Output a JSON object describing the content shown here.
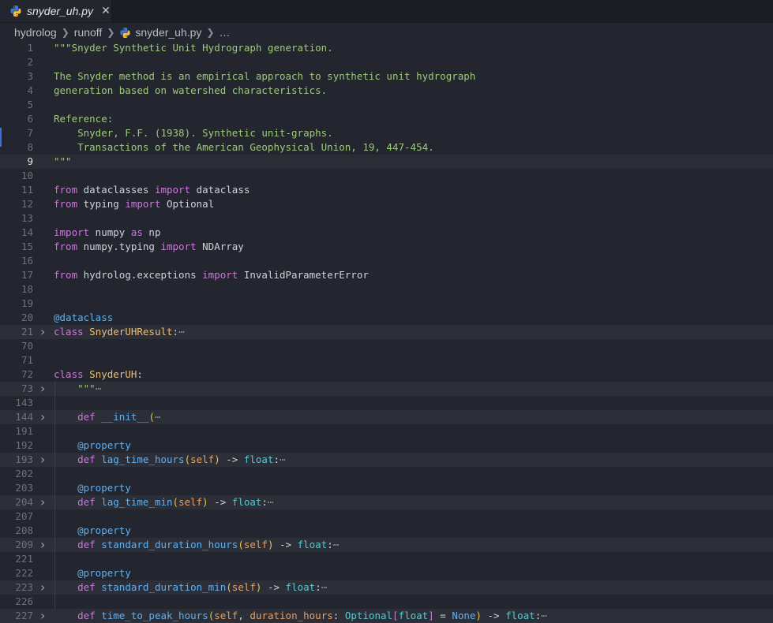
{
  "tab": {
    "filename": "snyder_uh.py",
    "close": "✕"
  },
  "breadcrumb": {
    "items": [
      "hydrolog",
      "runoff",
      "snyder_uh.py",
      "…"
    ]
  },
  "lines": [
    {
      "n": "1",
      "tokens": [
        [
          "str",
          "\"\"\"Snyder Synthetic Unit Hydrograph generation."
        ]
      ]
    },
    {
      "n": "2",
      "tokens": []
    },
    {
      "n": "3",
      "tokens": [
        [
          "str",
          "The Snyder method is an empirical approach to synthetic unit hydrograph"
        ]
      ]
    },
    {
      "n": "4",
      "tokens": [
        [
          "str",
          "generation based on watershed characteristics."
        ]
      ]
    },
    {
      "n": "5",
      "tokens": []
    },
    {
      "n": "6",
      "tokens": [
        [
          "str",
          "Reference:"
        ]
      ]
    },
    {
      "n": "7",
      "tokens": [
        [
          "str",
          "    Snyder, F.F. (1938). Synthetic unit-graphs."
        ]
      ]
    },
    {
      "n": "8",
      "tokens": [
        [
          "str",
          "    Transactions of the American Geophysical Union, 19, 447-454."
        ]
      ]
    },
    {
      "n": "9",
      "active": true,
      "tokens": [
        [
          "str",
          "\"\"\""
        ]
      ]
    },
    {
      "n": "10",
      "tokens": []
    },
    {
      "n": "11",
      "tokens": [
        [
          "kw",
          "from"
        ],
        [
          "",
          " dataclasses "
        ],
        [
          "kw",
          "import"
        ],
        [
          "",
          " dataclass"
        ]
      ]
    },
    {
      "n": "12",
      "tokens": [
        [
          "kw",
          "from"
        ],
        [
          "",
          " typing "
        ],
        [
          "kw",
          "import"
        ],
        [
          "",
          " Optional"
        ]
      ]
    },
    {
      "n": "13",
      "tokens": []
    },
    {
      "n": "14",
      "tokens": [
        [
          "kw",
          "import"
        ],
        [
          "",
          " numpy "
        ],
        [
          "kw",
          "as"
        ],
        [
          "",
          " np"
        ]
      ]
    },
    {
      "n": "15",
      "tokens": [
        [
          "kw",
          "from"
        ],
        [
          "",
          " numpy.typing "
        ],
        [
          "kw",
          "import"
        ],
        [
          "",
          " NDArray"
        ]
      ]
    },
    {
      "n": "16",
      "tokens": []
    },
    {
      "n": "17",
      "tokens": [
        [
          "kw",
          "from"
        ],
        [
          "",
          " hydrolog.exceptions "
        ],
        [
          "kw",
          "import"
        ],
        [
          "",
          " InvalidParameterError"
        ]
      ]
    },
    {
      "n": "18",
      "tokens": []
    },
    {
      "n": "19",
      "tokens": []
    },
    {
      "n": "20",
      "tokens": [
        [
          "fn",
          "@dataclass"
        ]
      ]
    },
    {
      "n": "21",
      "fold": true,
      "tokens": [
        [
          "kw",
          "class"
        ],
        [
          "",
          " "
        ],
        [
          "cls",
          "SnyderUHResult"
        ],
        [
          "",
          ":"
        ],
        [
          "ell",
          "⋯"
        ]
      ]
    },
    {
      "n": "70",
      "tokens": []
    },
    {
      "n": "71",
      "tokens": []
    },
    {
      "n": "72",
      "tokens": [
        [
          "kw",
          "class"
        ],
        [
          "",
          " "
        ],
        [
          "cls",
          "SnyderUH"
        ],
        [
          "",
          ":"
        ]
      ]
    },
    {
      "n": "73",
      "fold": true,
      "tokens": [
        [
          "",
          "    "
        ],
        [
          "str",
          "\"\"\""
        ],
        [
          "ell",
          "⋯"
        ]
      ]
    },
    {
      "n": "143",
      "tokens": []
    },
    {
      "n": "144",
      "fold": true,
      "tokens": [
        [
          "",
          "    "
        ],
        [
          "kw",
          "def"
        ],
        [
          "",
          " "
        ],
        [
          "fn",
          "__init__"
        ],
        [
          "par",
          "("
        ],
        [
          "ell",
          "⋯"
        ]
      ]
    },
    {
      "n": "191",
      "tokens": []
    },
    {
      "n": "192",
      "tokens": [
        [
          "",
          "    "
        ],
        [
          "fn",
          "@property"
        ]
      ]
    },
    {
      "n": "193",
      "fold": true,
      "tokens": [
        [
          "",
          "    "
        ],
        [
          "kw",
          "def"
        ],
        [
          "",
          " "
        ],
        [
          "fn",
          "lag_time_hours"
        ],
        [
          "par",
          "("
        ],
        [
          "self",
          "self"
        ],
        [
          "par",
          ")"
        ],
        [
          "",
          " -> "
        ],
        [
          "typ",
          "float"
        ],
        [
          "",
          ":"
        ],
        [
          "ell",
          "⋯"
        ]
      ]
    },
    {
      "n": "202",
      "tokens": []
    },
    {
      "n": "203",
      "tokens": [
        [
          "",
          "    "
        ],
        [
          "fn",
          "@property"
        ]
      ]
    },
    {
      "n": "204",
      "fold": true,
      "tokens": [
        [
          "",
          "    "
        ],
        [
          "kw",
          "def"
        ],
        [
          "",
          " "
        ],
        [
          "fn",
          "lag_time_min"
        ],
        [
          "par",
          "("
        ],
        [
          "self",
          "self"
        ],
        [
          "par",
          ")"
        ],
        [
          "",
          " -> "
        ],
        [
          "typ",
          "float"
        ],
        [
          "",
          ":"
        ],
        [
          "ell",
          "⋯"
        ]
      ]
    },
    {
      "n": "207",
      "tokens": []
    },
    {
      "n": "208",
      "tokens": [
        [
          "",
          "    "
        ],
        [
          "fn",
          "@property"
        ]
      ]
    },
    {
      "n": "209",
      "fold": true,
      "tokens": [
        [
          "",
          "    "
        ],
        [
          "kw",
          "def"
        ],
        [
          "",
          " "
        ],
        [
          "fn",
          "standard_duration_hours"
        ],
        [
          "par",
          "("
        ],
        [
          "self",
          "self"
        ],
        [
          "par",
          ")"
        ],
        [
          "",
          " -> "
        ],
        [
          "typ",
          "float"
        ],
        [
          "",
          ":"
        ],
        [
          "ell",
          "⋯"
        ]
      ]
    },
    {
      "n": "221",
      "tokens": []
    },
    {
      "n": "222",
      "tokens": [
        [
          "",
          "    "
        ],
        [
          "fn",
          "@property"
        ]
      ]
    },
    {
      "n": "223",
      "fold": true,
      "tokens": [
        [
          "",
          "    "
        ],
        [
          "kw",
          "def"
        ],
        [
          "",
          " "
        ],
        [
          "fn",
          "standard_duration_min"
        ],
        [
          "par",
          "("
        ],
        [
          "self",
          "self"
        ],
        [
          "par",
          ")"
        ],
        [
          "",
          " -> "
        ],
        [
          "typ",
          "float"
        ],
        [
          "",
          ":"
        ],
        [
          "ell",
          "⋯"
        ]
      ]
    },
    {
      "n": "226",
      "tokens": []
    },
    {
      "n": "227",
      "fold": true,
      "tokens": [
        [
          "",
          "    "
        ],
        [
          "kw",
          "def"
        ],
        [
          "",
          " "
        ],
        [
          "fn",
          "time_to_peak_hours"
        ],
        [
          "par",
          "("
        ],
        [
          "self",
          "self"
        ],
        [
          "",
          ", "
        ],
        [
          "self",
          "duration_hours"
        ],
        [
          "",
          ": "
        ],
        [
          "typ",
          "Optional"
        ],
        [
          "par2",
          "["
        ],
        [
          "typ",
          "float"
        ],
        [
          "par2",
          "]"
        ],
        [
          "",
          " = "
        ],
        [
          "fn",
          "None"
        ],
        [
          "par",
          ")"
        ],
        [
          "",
          " -> "
        ],
        [
          "typ",
          "float"
        ],
        [
          "",
          ":"
        ],
        [
          "ell",
          "⋯"
        ]
      ]
    }
  ]
}
